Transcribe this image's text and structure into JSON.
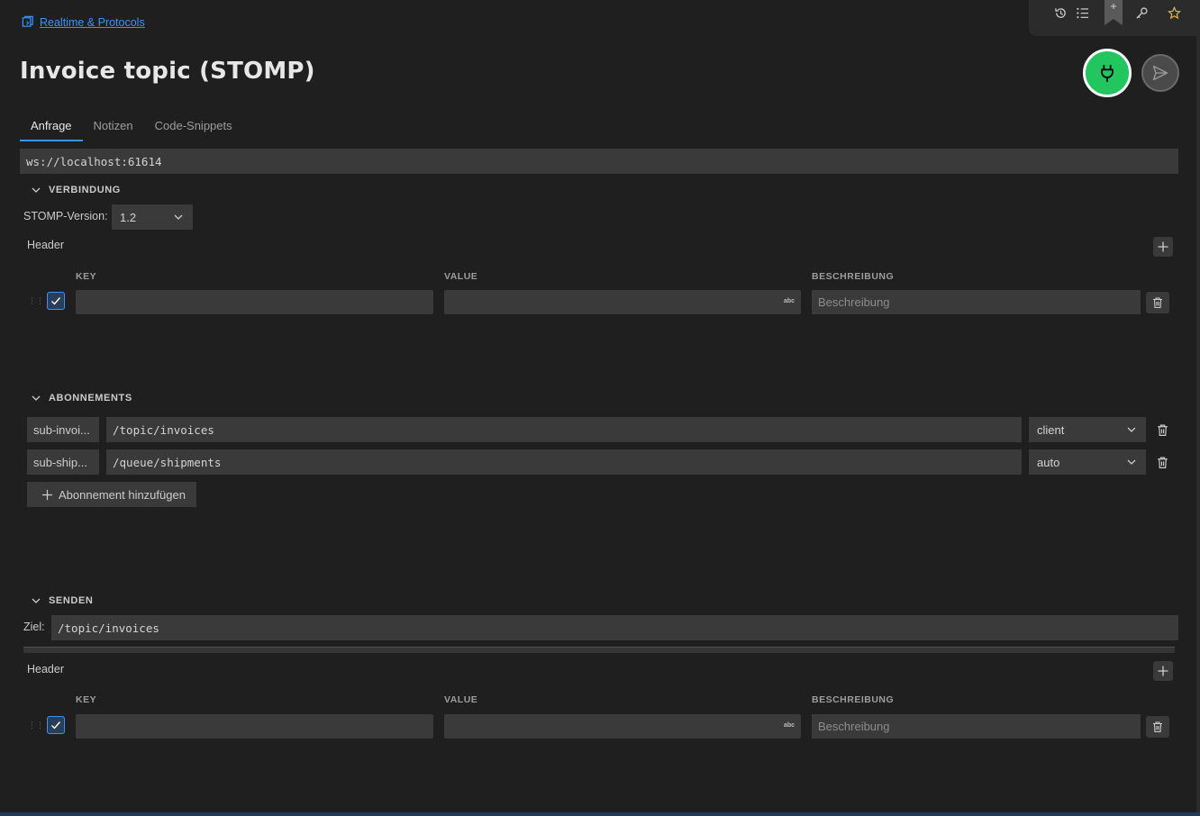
{
  "breadcrumb": {
    "label": "Realtime & Protocols"
  },
  "title": "Invoice topic (STOMP)",
  "tabs": [
    {
      "label": "Anfrage",
      "active": true
    },
    {
      "label": "Notizen",
      "active": false
    },
    {
      "label": "Code-Snippets",
      "active": false
    }
  ],
  "url": "ws://localhost:61614",
  "connection": {
    "section_label": "VERBINDUNG",
    "stomp_version_label": "STOMP-Version:",
    "stomp_version_value": "1.2",
    "header_label": "Header",
    "columns": {
      "key": "KEY",
      "value": "VALUE",
      "description": "BESCHREIBUNG"
    },
    "row": {
      "key": "",
      "value": "",
      "description_placeholder": "Beschreibung",
      "checked": true,
      "abc": "abc"
    }
  },
  "subscriptions": {
    "section_label": "ABONNEMENTS",
    "items": [
      {
        "name": "sub-invoi...",
        "destination": "/topic/invoices",
        "ack": "client"
      },
      {
        "name": "sub-ship...",
        "destination": "/queue/shipments",
        "ack": "auto"
      }
    ],
    "add_label": "Abonnement hinzufügen"
  },
  "send": {
    "section_label": "SENDEN",
    "target_label": "Ziel:",
    "target_value": "/topic/invoices",
    "header_label": "Header",
    "columns": {
      "key": "KEY",
      "value": "VALUE",
      "description": "BESCHREIBUNG"
    },
    "row": {
      "key": "",
      "value": "",
      "description_placeholder": "Beschreibung",
      "checked": true,
      "abc": "abc"
    }
  },
  "colors": {
    "accent": "#3794ff",
    "connect": "#23c55e",
    "background": "#1f1f1f",
    "field": "#3a3a3a"
  },
  "icons": [
    "history-icon",
    "list-icon",
    "bookmark-icon",
    "key-icon",
    "star-icon",
    "plug-icon",
    "send-icon",
    "trash-icon",
    "plus-icon",
    "chevron-down-icon",
    "check-icon",
    "drag-handle-icon",
    "collection-icon"
  ]
}
